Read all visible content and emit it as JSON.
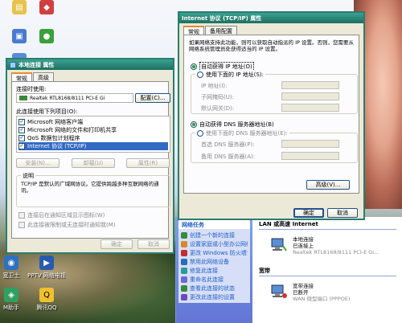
{
  "desktop": {
    "icons": [
      {
        "label": "",
        "icon": "folder-icon"
      },
      {
        "label": "",
        "icon": "app-icon"
      },
      {
        "label": "",
        "icon": "network-icon"
      },
      {
        "label": "",
        "icon": "app-icon"
      },
      {
        "label": "",
        "icon": "app-icon"
      },
      {
        "label": "",
        "icon": "app-icon"
      },
      {
        "label": "宽卫士",
        "icon": "app-icon"
      },
      {
        "label": "PPTV 网络电视",
        "icon": "pptv-icon"
      },
      {
        "label": "M助手",
        "icon": "app-icon"
      },
      {
        "label": "腾讯QQ",
        "icon": "qq-icon"
      }
    ]
  },
  "lan_props": {
    "title": "本地连接 属性",
    "tabs": [
      "常规",
      "高级"
    ],
    "connect_using_label": "连接时使用:",
    "adapter_name": "Realtek RTL8168/8111 PCI-E Gi",
    "configure_button": "配置(C)...",
    "items_label": "此连接使用下列项目(O):",
    "items": [
      {
        "label": "Microsoft 网络客户端",
        "checked": true
      },
      {
        "label": "Microsoft 网络的文件和打印机共享",
        "checked": true
      },
      {
        "label": "QoS 数据包计划程序",
        "checked": true
      },
      {
        "label": "Internet 协议 (TCP/IP)",
        "checked": true
      }
    ],
    "install_button": "安装(N)...",
    "uninstall_button": "卸载(U)",
    "properties_button": "属性(R)",
    "description_title": "说明",
    "description_text": "TCP/IP 是默认的广域网协议。它提供跨越多种互联网络的通讯。",
    "option1": "连接后在通知区域显示图标(W)",
    "option2": "此连接被限制或无连接时通知我(M)",
    "ok_button": "确定",
    "cancel_button": "取消"
  },
  "tcpip": {
    "title": "Internet 协议 (TCP/IP) 属性",
    "tabs": [
      "常规",
      "备用配置"
    ],
    "intro": "如果网络支持此功能，则可以获取自动指派的 IP 设置。否则，您需要从网络系统管理员处获得适当的 IP 设置。",
    "auto_ip": "自动获得 IP 地址(O)",
    "manual_ip": "使用下面的 IP 地址(S):",
    "ip_label": "IP 地址(I):",
    "mask_label": "子网掩码(U):",
    "gateway_label": "默认网关(D):",
    "auto_dns": "自动获得 DNS 服务器地址(B)",
    "manual_dns": "使用下面的 DNS 服务器地址(E):",
    "dns1_label": "首选 DNS 服务器(P):",
    "dns2_label": "备用 DNS 服务器(A):",
    "advanced_button": "高级(V)...",
    "ok_button": "确定",
    "cancel_button": "取消"
  },
  "explorer": {
    "tasks_title": "网络任务",
    "tasks": [
      {
        "label": "创建一个新的连接",
        "color": "#3a8a3a"
      },
      {
        "label": "设置家庭或小型办公网络",
        "color": "#d48a2a"
      },
      {
        "label": "更改 Windows 防火墙设置",
        "color": "#c03030"
      },
      {
        "label": "禁用此网络设备",
        "color": "#2a6ac0"
      },
      {
        "label": "修复此连接",
        "color": "#2a9a9a"
      },
      {
        "label": "重命名此连接",
        "color": "#6a6ad0"
      },
      {
        "label": "查看此连接的状态",
        "color": "#3a8a3a"
      },
      {
        "label": "更改此连接的设置",
        "color": "#6a4ac0"
      }
    ],
    "lan_section": "LAN 或高速 Internet",
    "lan_conn": {
      "name": "本地连接",
      "status": "已连接上",
      "device": "Realtek RTL8168/8111 PCI-E Gi..."
    },
    "broadband_section": "宽带",
    "bb_conn": {
      "name": "宽带连接",
      "status": "已断开",
      "device": "WAN 微型端口 (PPPOE)"
    }
  }
}
